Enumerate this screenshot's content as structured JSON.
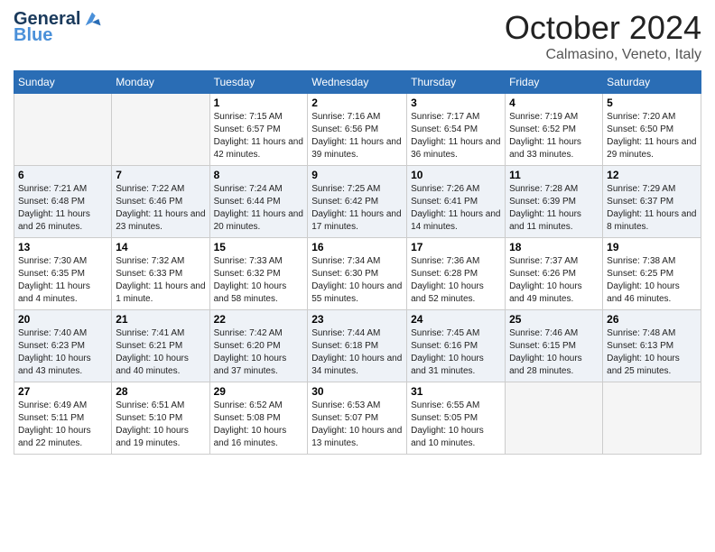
{
  "header": {
    "logo_line1": "General",
    "logo_line2": "Blue",
    "month": "October 2024",
    "location": "Calmasino, Veneto, Italy"
  },
  "days_of_week": [
    "Sunday",
    "Monday",
    "Tuesday",
    "Wednesday",
    "Thursday",
    "Friday",
    "Saturday"
  ],
  "weeks": [
    [
      {
        "day": "",
        "sunrise": "",
        "sunset": "",
        "daylight": ""
      },
      {
        "day": "",
        "sunrise": "",
        "sunset": "",
        "daylight": ""
      },
      {
        "day": "1",
        "sunrise": "Sunrise: 7:15 AM",
        "sunset": "Sunset: 6:57 PM",
        "daylight": "Daylight: 11 hours and 42 minutes."
      },
      {
        "day": "2",
        "sunrise": "Sunrise: 7:16 AM",
        "sunset": "Sunset: 6:56 PM",
        "daylight": "Daylight: 11 hours and 39 minutes."
      },
      {
        "day": "3",
        "sunrise": "Sunrise: 7:17 AM",
        "sunset": "Sunset: 6:54 PM",
        "daylight": "Daylight: 11 hours and 36 minutes."
      },
      {
        "day": "4",
        "sunrise": "Sunrise: 7:19 AM",
        "sunset": "Sunset: 6:52 PM",
        "daylight": "Daylight: 11 hours and 33 minutes."
      },
      {
        "day": "5",
        "sunrise": "Sunrise: 7:20 AM",
        "sunset": "Sunset: 6:50 PM",
        "daylight": "Daylight: 11 hours and 29 minutes."
      }
    ],
    [
      {
        "day": "6",
        "sunrise": "Sunrise: 7:21 AM",
        "sunset": "Sunset: 6:48 PM",
        "daylight": "Daylight: 11 hours and 26 minutes."
      },
      {
        "day": "7",
        "sunrise": "Sunrise: 7:22 AM",
        "sunset": "Sunset: 6:46 PM",
        "daylight": "Daylight: 11 hours and 23 minutes."
      },
      {
        "day": "8",
        "sunrise": "Sunrise: 7:24 AM",
        "sunset": "Sunset: 6:44 PM",
        "daylight": "Daylight: 11 hours and 20 minutes."
      },
      {
        "day": "9",
        "sunrise": "Sunrise: 7:25 AM",
        "sunset": "Sunset: 6:42 PM",
        "daylight": "Daylight: 11 hours and 17 minutes."
      },
      {
        "day": "10",
        "sunrise": "Sunrise: 7:26 AM",
        "sunset": "Sunset: 6:41 PM",
        "daylight": "Daylight: 11 hours and 14 minutes."
      },
      {
        "day": "11",
        "sunrise": "Sunrise: 7:28 AM",
        "sunset": "Sunset: 6:39 PM",
        "daylight": "Daylight: 11 hours and 11 minutes."
      },
      {
        "day": "12",
        "sunrise": "Sunrise: 7:29 AM",
        "sunset": "Sunset: 6:37 PM",
        "daylight": "Daylight: 11 hours and 8 minutes."
      }
    ],
    [
      {
        "day": "13",
        "sunrise": "Sunrise: 7:30 AM",
        "sunset": "Sunset: 6:35 PM",
        "daylight": "Daylight: 11 hours and 4 minutes."
      },
      {
        "day": "14",
        "sunrise": "Sunrise: 7:32 AM",
        "sunset": "Sunset: 6:33 PM",
        "daylight": "Daylight: 11 hours and 1 minute."
      },
      {
        "day": "15",
        "sunrise": "Sunrise: 7:33 AM",
        "sunset": "Sunset: 6:32 PM",
        "daylight": "Daylight: 10 hours and 58 minutes."
      },
      {
        "day": "16",
        "sunrise": "Sunrise: 7:34 AM",
        "sunset": "Sunset: 6:30 PM",
        "daylight": "Daylight: 10 hours and 55 minutes."
      },
      {
        "day": "17",
        "sunrise": "Sunrise: 7:36 AM",
        "sunset": "Sunset: 6:28 PM",
        "daylight": "Daylight: 10 hours and 52 minutes."
      },
      {
        "day": "18",
        "sunrise": "Sunrise: 7:37 AM",
        "sunset": "Sunset: 6:26 PM",
        "daylight": "Daylight: 10 hours and 49 minutes."
      },
      {
        "day": "19",
        "sunrise": "Sunrise: 7:38 AM",
        "sunset": "Sunset: 6:25 PM",
        "daylight": "Daylight: 10 hours and 46 minutes."
      }
    ],
    [
      {
        "day": "20",
        "sunrise": "Sunrise: 7:40 AM",
        "sunset": "Sunset: 6:23 PM",
        "daylight": "Daylight: 10 hours and 43 minutes."
      },
      {
        "day": "21",
        "sunrise": "Sunrise: 7:41 AM",
        "sunset": "Sunset: 6:21 PM",
        "daylight": "Daylight: 10 hours and 40 minutes."
      },
      {
        "day": "22",
        "sunrise": "Sunrise: 7:42 AM",
        "sunset": "Sunset: 6:20 PM",
        "daylight": "Daylight: 10 hours and 37 minutes."
      },
      {
        "day": "23",
        "sunrise": "Sunrise: 7:44 AM",
        "sunset": "Sunset: 6:18 PM",
        "daylight": "Daylight: 10 hours and 34 minutes."
      },
      {
        "day": "24",
        "sunrise": "Sunrise: 7:45 AM",
        "sunset": "Sunset: 6:16 PM",
        "daylight": "Daylight: 10 hours and 31 minutes."
      },
      {
        "day": "25",
        "sunrise": "Sunrise: 7:46 AM",
        "sunset": "Sunset: 6:15 PM",
        "daylight": "Daylight: 10 hours and 28 minutes."
      },
      {
        "day": "26",
        "sunrise": "Sunrise: 7:48 AM",
        "sunset": "Sunset: 6:13 PM",
        "daylight": "Daylight: 10 hours and 25 minutes."
      }
    ],
    [
      {
        "day": "27",
        "sunrise": "Sunrise: 6:49 AM",
        "sunset": "Sunset: 5:11 PM",
        "daylight": "Daylight: 10 hours and 22 minutes."
      },
      {
        "day": "28",
        "sunrise": "Sunrise: 6:51 AM",
        "sunset": "Sunset: 5:10 PM",
        "daylight": "Daylight: 10 hours and 19 minutes."
      },
      {
        "day": "29",
        "sunrise": "Sunrise: 6:52 AM",
        "sunset": "Sunset: 5:08 PM",
        "daylight": "Daylight: 10 hours and 16 minutes."
      },
      {
        "day": "30",
        "sunrise": "Sunrise: 6:53 AM",
        "sunset": "Sunset: 5:07 PM",
        "daylight": "Daylight: 10 hours and 13 minutes."
      },
      {
        "day": "31",
        "sunrise": "Sunrise: 6:55 AM",
        "sunset": "Sunset: 5:05 PM",
        "daylight": "Daylight: 10 hours and 10 minutes."
      },
      {
        "day": "",
        "sunrise": "",
        "sunset": "",
        "daylight": ""
      },
      {
        "day": "",
        "sunrise": "",
        "sunset": "",
        "daylight": ""
      }
    ]
  ]
}
